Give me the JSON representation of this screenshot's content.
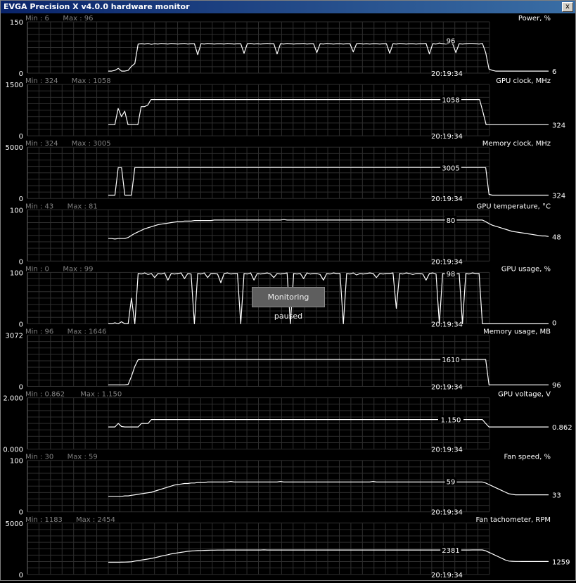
{
  "window": {
    "title": "EVGA Precision X v4.0.0 hardware monitor",
    "close_label": "x",
    "paused_label": "Monitoring paused"
  },
  "colors": {
    "background": "#000000",
    "grid": "#2e2e2e",
    "line": "#ffffff",
    "dim_text": "#808080",
    "text": "#ffffff"
  },
  "chart_data": [
    {
      "type": "line",
      "title": "Power, %",
      "min_label": "Min : 6",
      "max_label": "Max : 96",
      "ylim": [
        0,
        150
      ],
      "ytick_labels": [
        "150",
        "0"
      ],
      "current_label": "96",
      "end_label": "6",
      "time_label": "20:19:34",
      "values": [
        6,
        6,
        8,
        14,
        6,
        6,
        8,
        20,
        28,
        85,
        86,
        85,
        87,
        84,
        86,
        85,
        87,
        86,
        85,
        87,
        86,
        85,
        86,
        87,
        85,
        86,
        86,
        54,
        86,
        85,
        87,
        86,
        85,
        86,
        86,
        85,
        87,
        86,
        85,
        86,
        86,
        58,
        86,
        87,
        85,
        86,
        85,
        86,
        87,
        86,
        86,
        56,
        86,
        85,
        87,
        86,
        85,
        86,
        86,
        87,
        85,
        86,
        86,
        60,
        86,
        85,
        87,
        86,
        85,
        86,
        86,
        85,
        86,
        86,
        62,
        86,
        87,
        85,
        86,
        85,
        86,
        86,
        85,
        86,
        86,
        58,
        86,
        85,
        87,
        86,
        85,
        86,
        86,
        85,
        86,
        86,
        87,
        56,
        86,
        85,
        88,
        86,
        85,
        87,
        86,
        60,
        86,
        85,
        86,
        87,
        87,
        86,
        85,
        87,
        60,
        12,
        8,
        6,
        6,
        6,
        6,
        6,
        6,
        6,
        6,
        6,
        6,
        6,
        6,
        6,
        6,
        6,
        6,
        6
      ]
    },
    {
      "type": "line",
      "title": "GPU clock, MHz",
      "min_label": "Min : 324",
      "max_label": "Max : 1058",
      "ylim": [
        0,
        1500
      ],
      "ytick_labels": [
        "1500",
        "0"
      ],
      "current_label": "1058",
      "end_label": "324",
      "time_label": "20:19:34",
      "values": [
        324,
        324,
        324,
        800,
        560,
        720,
        324,
        324,
        324,
        324,
        850,
        850,
        900,
        1058,
        1058,
        1058,
        1058,
        1058,
        1058,
        1058,
        1058,
        1058,
        1058,
        1058,
        1058,
        1058,
        1058,
        1058,
        1058,
        1058,
        1058,
        1058,
        1058,
        1058,
        1058,
        1058,
        1058,
        1058,
        1058,
        1058,
        1058,
        1058,
        1058,
        1058,
        1058,
        1058,
        1058,
        1058,
        1058,
        1058,
        1058,
        1058,
        1058,
        1058,
        1058,
        1058,
        1058,
        1058,
        1058,
        1058,
        1058,
        1058,
        1058,
        1058,
        1058,
        1058,
        1058,
        1058,
        1058,
        1058,
        1058,
        1058,
        1058,
        1058,
        1058,
        1058,
        1058,
        1058,
        1058,
        1058,
        1058,
        1058,
        1058,
        1058,
        1058,
        1058,
        1058,
        1058,
        1058,
        1058,
        1058,
        1058,
        1058,
        1058,
        1058,
        1058,
        1058,
        1058,
        1058,
        1058,
        1058,
        1058,
        1058,
        1058,
        1058,
        1058,
        1058,
        1058,
        1058,
        1058,
        1058,
        1058,
        1058,
        1058,
        700,
        324,
        324,
        324,
        324,
        324,
        324,
        324,
        324,
        324,
        324,
        324,
        324,
        324,
        324,
        324,
        324,
        324,
        324,
        324,
        324
      ]
    },
    {
      "type": "line",
      "title": "Memory clock, MHz",
      "min_label": "Min : 324",
      "max_label": "Max : 3005",
      "ylim": [
        0,
        5000
      ],
      "ytick_labels": [
        "5000",
        "0"
      ],
      "current_label": "3005",
      "end_label": "324",
      "time_label": "20:19:34",
      "values": [
        324,
        324,
        324,
        3005,
        3005,
        324,
        324,
        324,
        3005,
        3005,
        3005,
        3005,
        3005,
        3005,
        3005,
        3005,
        3005,
        3005,
        3005,
        3005,
        3005,
        3005,
        3005,
        3005,
        3005,
        3005,
        3005,
        3005,
        3005,
        3005,
        3005,
        3005,
        3005,
        3005,
        3005,
        3005,
        3005,
        3005,
        3005,
        3005,
        3005,
        3005,
        3005,
        3005,
        3005,
        3005,
        3005,
        3005,
        3005,
        3005,
        3005,
        3005,
        3005,
        3005,
        3005,
        3005,
        3005,
        3005,
        3005,
        3005,
        3005,
        3005,
        3005,
        3005,
        3005,
        3005,
        3005,
        3005,
        3005,
        3005,
        3005,
        3005,
        3005,
        3005,
        3005,
        3005,
        3005,
        3005,
        3005,
        3005,
        3005,
        3005,
        3005,
        3005,
        3005,
        3005,
        3005,
        3005,
        3005,
        3005,
        3005,
        3005,
        3005,
        3005,
        3005,
        3005,
        3005,
        3005,
        3005,
        3005,
        3005,
        3005,
        3005,
        3005,
        3005,
        3005,
        3005,
        3005,
        3005,
        3005,
        3005,
        3005,
        3005,
        3005,
        3005,
        400,
        324,
        324,
        324,
        324,
        324,
        324,
        324,
        324,
        324,
        324,
        324,
        324,
        324,
        324,
        324,
        324,
        324,
        324
      ]
    },
    {
      "type": "line",
      "title": "GPU temperature, °C",
      "min_label": "Min : 43",
      "max_label": "Max : 81",
      "ylim": [
        0,
        100
      ],
      "ytick_labels": [
        "100",
        "0"
      ],
      "current_label": "80",
      "end_label": "48",
      "time_label": "20:19:34",
      "values": [
        44,
        44,
        43,
        44,
        44,
        44,
        46,
        50,
        54,
        57,
        60,
        63,
        65,
        67,
        69,
        71,
        72,
        73,
        74,
        75,
        76,
        77,
        77,
        78,
        78,
        78,
        79,
        79,
        79,
        79,
        79,
        79,
        80,
        80,
        80,
        80,
        80,
        80,
        80,
        80,
        80,
        80,
        80,
        80,
        80,
        80,
        80,
        80,
        80,
        80,
        80,
        80,
        80,
        81,
        80,
        80,
        80,
        80,
        80,
        80,
        80,
        80,
        80,
        80,
        80,
        80,
        80,
        80,
        80,
        80,
        80,
        80,
        80,
        80,
        80,
        80,
        80,
        80,
        80,
        80,
        80,
        80,
        80,
        80,
        80,
        80,
        80,
        80,
        80,
        80,
        80,
        80,
        80,
        80,
        80,
        80,
        80,
        80,
        80,
        80,
        80,
        80,
        80,
        80,
        80,
        80,
        80,
        80,
        80,
        80,
        80,
        80,
        80,
        80,
        77,
        73,
        70,
        68,
        66,
        64,
        62,
        60,
        58,
        57,
        56,
        55,
        54,
        53,
        52,
        51,
        50,
        49,
        49,
        48
      ]
    },
    {
      "type": "line",
      "title": "GPU usage, %",
      "min_label": "Min : 0",
      "max_label": "Max : 99",
      "ylim": [
        0,
        100
      ],
      "ytick_labels": [
        "100",
        "0"
      ],
      "current_label": "98",
      "end_label": "0",
      "time_label": "20:19:34",
      "values": [
        0,
        0,
        2,
        0,
        4,
        0,
        0,
        50,
        0,
        98,
        97,
        99,
        96,
        98,
        90,
        98,
        97,
        99,
        85,
        98,
        97,
        98,
        99,
        88,
        98,
        97,
        0,
        98,
        97,
        99,
        90,
        98,
        98,
        97,
        80,
        98,
        99,
        97,
        98,
        98,
        0,
        98,
        97,
        99,
        85,
        98,
        97,
        98,
        99,
        97,
        90,
        98,
        97,
        98,
        99,
        0,
        98,
        97,
        98,
        88,
        99,
        97,
        98,
        98,
        96,
        85,
        98,
        97,
        99,
        98,
        98,
        0,
        98,
        97,
        99,
        95,
        98,
        97,
        98,
        99,
        98,
        90,
        98,
        97,
        98,
        98,
        99,
        30,
        98,
        97,
        99,
        98,
        96,
        98,
        98,
        97,
        85,
        98,
        99,
        97,
        0,
        98,
        97,
        99,
        98,
        97,
        98,
        0,
        98,
        97,
        99,
        98,
        98,
        0,
        0,
        0,
        0,
        0,
        0,
        0,
        0,
        0,
        0,
        0,
        0,
        0,
        0,
        0,
        0,
        0,
        0,
        0,
        0,
        0
      ]
    },
    {
      "type": "line",
      "title": "Memory usage, MB",
      "min_label": "Min : 96",
      "max_label": "Max : 1646",
      "ylim": [
        0,
        3072
      ],
      "ytick_labels": [
        "3072",
        "0"
      ],
      "current_label": "1610",
      "end_label": "96",
      "time_label": "20:19:34",
      "values": [
        96,
        96,
        96,
        96,
        96,
        96,
        120,
        600,
        1200,
        1600,
        1610,
        1610,
        1610,
        1610,
        1610,
        1610,
        1610,
        1610,
        1610,
        1610,
        1610,
        1610,
        1610,
        1610,
        1610,
        1610,
        1610,
        1610,
        1610,
        1610,
        1610,
        1610,
        1610,
        1610,
        1610,
        1610,
        1610,
        1610,
        1610,
        1610,
        1610,
        1610,
        1610,
        1610,
        1610,
        1610,
        1610,
        1610,
        1610,
        1610,
        1610,
        1610,
        1610,
        1610,
        1610,
        1610,
        1610,
        1610,
        1610,
        1610,
        1610,
        1610,
        1610,
        1610,
        1610,
        1610,
        1610,
        1610,
        1610,
        1610,
        1610,
        1610,
        1610,
        1610,
        1610,
        1610,
        1610,
        1610,
        1610,
        1610,
        1610,
        1610,
        1610,
        1610,
        1610,
        1610,
        1610,
        1610,
        1610,
        1610,
        1610,
        1610,
        1610,
        1610,
        1610,
        1610,
        1610,
        1610,
        1610,
        1610,
        1610,
        1610,
        1610,
        1610,
        1610,
        1610,
        1610,
        1610,
        1610,
        1610,
        1610,
        1610,
        1610,
        1610,
        1610,
        96,
        96,
        96,
        96,
        96,
        96,
        96,
        96,
        96,
        96,
        96,
        96,
        96,
        96,
        96,
        96,
        96,
        96,
        96
      ]
    },
    {
      "type": "line",
      "title": "GPU voltage, V",
      "min_label": "Min : 0.862",
      "max_label": "Max : 1.150",
      "ylim": [
        0,
        2
      ],
      "ytick_labels": [
        "2.000",
        "0.000"
      ],
      "current_label": "1.150",
      "end_label": "0.862",
      "time_label": "20:19:34",
      "values": [
        0.862,
        0.862,
        0.862,
        1.0,
        0.88,
        0.862,
        0.862,
        0.862,
        0.862,
        0.862,
        1.0,
        1.0,
        1.0,
        1.15,
        1.15,
        1.15,
        1.15,
        1.15,
        1.15,
        1.15,
        1.15,
        1.15,
        1.15,
        1.15,
        1.15,
        1.15,
        1.15,
        1.15,
        1.15,
        1.15,
        1.15,
        1.15,
        1.15,
        1.15,
        1.15,
        1.15,
        1.15,
        1.15,
        1.15,
        1.15,
        1.15,
        1.15,
        1.15,
        1.15,
        1.15,
        1.15,
        1.15,
        1.15,
        1.15,
        1.15,
        1.15,
        1.15,
        1.15,
        1.15,
        1.15,
        1.15,
        1.15,
        1.15,
        1.15,
        1.15,
        1.15,
        1.15,
        1.15,
        1.15,
        1.15,
        1.15,
        1.15,
        1.15,
        1.15,
        1.15,
        1.15,
        1.15,
        1.15,
        1.15,
        1.15,
        1.15,
        1.15,
        1.15,
        1.15,
        1.15,
        1.15,
        1.15,
        1.15,
        1.15,
        1.15,
        1.15,
        1.15,
        1.15,
        1.15,
        1.15,
        1.15,
        1.15,
        1.15,
        1.15,
        1.15,
        1.15,
        1.15,
        1.15,
        1.15,
        1.15,
        1.15,
        1.15,
        1.15,
        1.15,
        1.15,
        1.15,
        1.15,
        1.15,
        1.15,
        1.15,
        1.15,
        1.15,
        1.15,
        1.15,
        1.0,
        0.862,
        0.862,
        0.862,
        0.862,
        0.862,
        0.862,
        0.862,
        0.862,
        0.862,
        0.862,
        0.862,
        0.862,
        0.862,
        0.862,
        0.862,
        0.862,
        0.862,
        0.862,
        0.862
      ]
    },
    {
      "type": "line",
      "title": "Fan speed, %",
      "min_label": "Min : 30",
      "max_label": "Max : 59",
      "ylim": [
        0,
        100
      ],
      "ytick_labels": [
        "100",
        "0"
      ],
      "current_label": "59",
      "end_label": "33",
      "time_label": "20:19:34",
      "values": [
        30,
        30,
        30,
        30,
        30,
        31,
        31,
        32,
        33,
        34,
        35,
        36,
        37,
        38,
        40,
        42,
        44,
        46,
        48,
        50,
        52,
        53,
        54,
        55,
        55,
        56,
        56,
        57,
        57,
        57,
        58,
        58,
        58,
        58,
        58,
        58,
        58,
        59,
        58,
        58,
        58,
        58,
        58,
        58,
        58,
        58,
        58,
        58,
        58,
        58,
        58,
        58,
        59,
        58,
        58,
        58,
        58,
        58,
        58,
        58,
        58,
        58,
        58,
        58,
        58,
        58,
        58,
        58,
        58,
        58,
        58,
        58,
        58,
        58,
        58,
        58,
        58,
        58,
        58,
        58,
        59,
        58,
        58,
        58,
        58,
        58,
        58,
        58,
        58,
        58,
        58,
        58,
        58,
        58,
        58,
        58,
        58,
        58,
        58,
        58,
        58,
        58,
        58,
        58,
        58,
        58,
        58,
        58,
        58,
        58,
        58,
        58,
        58,
        58,
        56,
        53,
        50,
        47,
        44,
        41,
        38,
        35,
        34,
        33,
        33,
        33,
        33,
        33,
        33,
        33,
        33,
        33,
        33,
        33
      ]
    },
    {
      "type": "line",
      "title": "Fan tachometer, RPM",
      "min_label": "Min : 1183",
      "max_label": "Max : 2454",
      "ylim": [
        0,
        5000
      ],
      "ytick_labels": [
        "5000",
        "0"
      ],
      "current_label": "2381",
      "end_label": "1259",
      "time_label": "20:19:34",
      "values": [
        1183,
        1183,
        1183,
        1183,
        1190,
        1200,
        1210,
        1230,
        1300,
        1350,
        1400,
        1450,
        1500,
        1560,
        1620,
        1700,
        1780,
        1850,
        1920,
        2000,
        2050,
        2100,
        2150,
        2200,
        2250,
        2280,
        2300,
        2320,
        2330,
        2340,
        2350,
        2360,
        2360,
        2370,
        2370,
        2370,
        2380,
        2380,
        2380,
        2380,
        2380,
        2380,
        2380,
        2380,
        2380,
        2380,
        2380,
        2390,
        2380,
        2380,
        2380,
        2380,
        2380,
        2380,
        2380,
        2380,
        2380,
        2380,
        2380,
        2380,
        2380,
        2380,
        2380,
        2380,
        2380,
        2380,
        2380,
        2380,
        2380,
        2380,
        2380,
        2380,
        2380,
        2380,
        2380,
        2380,
        2380,
        2380,
        2380,
        2380,
        2380,
        2380,
        2380,
        2380,
        2380,
        2380,
        2380,
        2380,
        2380,
        2380,
        2380,
        2380,
        2380,
        2380,
        2380,
        2380,
        2380,
        2380,
        2380,
        2380,
        2380,
        2380,
        2380,
        2380,
        2380,
        2380,
        2380,
        2380,
        2380,
        2380,
        2381,
        2381,
        2381,
        2381,
        2300,
        2150,
        2000,
        1850,
        1700,
        1550,
        1400,
        1300,
        1280,
        1270,
        1265,
        1260,
        1259,
        1259,
        1259,
        1259,
        1259,
        1259,
        1259,
        1259
      ]
    }
  ]
}
